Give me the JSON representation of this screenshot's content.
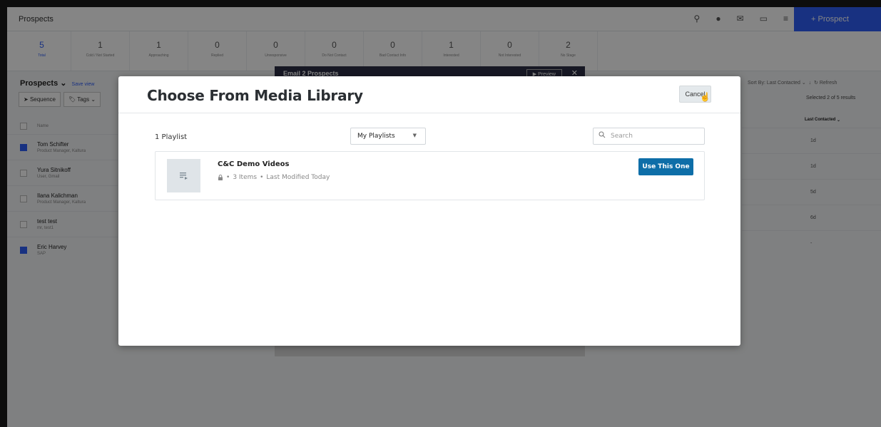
{
  "app": {
    "title": "Prospects",
    "add_button": "+ Prospect",
    "stats": [
      {
        "n": "5",
        "label": "Total"
      },
      {
        "n": "1",
        "label": "Cold / Not Started"
      },
      {
        "n": "1",
        "label": "Approaching"
      },
      {
        "n": "0",
        "label": "Replied"
      },
      {
        "n": "0",
        "label": "Unresponsive"
      },
      {
        "n": "0",
        "label": "Do Not Contact"
      },
      {
        "n": "0",
        "label": "Bad Contact Info"
      },
      {
        "n": "1",
        "label": "Interested"
      },
      {
        "n": "0",
        "label": "Not Interested"
      },
      {
        "n": "2",
        "label": "No Stage"
      }
    ],
    "left": {
      "heading": "Prospects",
      "save_view": "Save view",
      "sequence_btn": "Sequence",
      "tags_btn": "Tags",
      "col_name": "Name",
      "rows": [
        {
          "name": "Tom Schifter",
          "sub": "Product Manager, Kaltura",
          "checked": true
        },
        {
          "name": "Yura Sitnikoff",
          "sub": "User, Gmail",
          "checked": false
        },
        {
          "name": "Ilana Kalichman",
          "sub": "Product Manager, Kaltura",
          "checked": false
        },
        {
          "name": "test test",
          "sub": "mr, test1",
          "checked": false
        },
        {
          "name": "Eric Harvey",
          "sub": "SAP",
          "checked": true
        }
      ]
    },
    "right": {
      "sort": "Sort By: Last Contacted",
      "refresh": "Refresh",
      "selected": "Selected 2 of 5 results",
      "col_last": "Last Contacted",
      "values": [
        "1d",
        "1d",
        "5d",
        "6d",
        "-"
      ]
    },
    "email_modal": {
      "title": "Email 2 Prospects",
      "preview": "Preview"
    }
  },
  "modal": {
    "title": "Choose From Media Library",
    "cancel": "Cancel",
    "count": "1 Playlist",
    "filter": "My Playlists",
    "search_placeholder": "Search",
    "playlist": {
      "name": "C&C Demo Videos",
      "items": "3 Items",
      "modified": "Last Modified Today",
      "action": "Use This One"
    }
  }
}
